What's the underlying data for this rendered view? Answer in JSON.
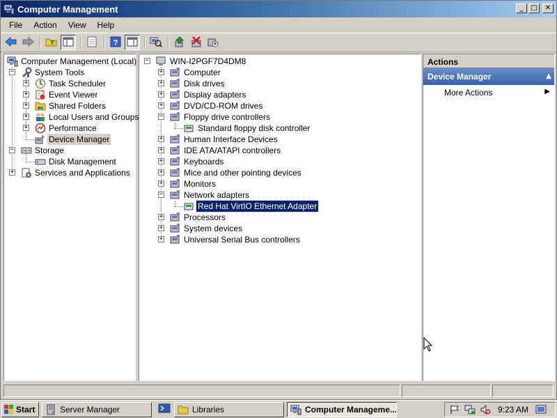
{
  "window": {
    "title": "Computer Management",
    "controls": {
      "minimize": "_",
      "maximize": "□",
      "close": "✕"
    }
  },
  "menu": [
    "File",
    "Action",
    "View",
    "Help"
  ],
  "toolbar": {
    "icons": [
      "back-arrow-icon",
      "forward-arrow-icon",
      "up-folder-icon",
      "show-hide-tree-icon",
      "properties-icon",
      "help-icon",
      "show-hide-action-pane-icon",
      "scan-hardware-icon",
      "update-driver-icon",
      "disable-device-icon",
      "uninstall-device-icon"
    ]
  },
  "left_tree": {
    "root": "Computer Management (Local)",
    "items": [
      {
        "label": "System Tools",
        "expander": "−"
      },
      {
        "label": "Task Scheduler",
        "expander": "+"
      },
      {
        "label": "Event Viewer",
        "expander": "+"
      },
      {
        "label": "Shared Folders",
        "expander": "+"
      },
      {
        "label": "Local Users and Groups",
        "expander": "+"
      },
      {
        "label": "Performance",
        "expander": "+"
      },
      {
        "label": "Device Manager",
        "expander": ""
      },
      {
        "label": "Storage",
        "expander": "−"
      },
      {
        "label": "Disk Management",
        "expander": ""
      },
      {
        "label": "Services and Applications",
        "expander": "+"
      }
    ]
  },
  "device_tree": {
    "root": "WIN-I2PGF7D4DM8",
    "items": [
      {
        "label": "Computer",
        "expander": "+"
      },
      {
        "label": "Disk drives",
        "expander": "+"
      },
      {
        "label": "Display adapters",
        "expander": "+"
      },
      {
        "label": "DVD/CD-ROM drives",
        "expander": "+"
      },
      {
        "label": "Floppy drive controllers",
        "expander": "−"
      },
      {
        "label": "Standard floppy disk controller",
        "expander": ""
      },
      {
        "label": "Human Interface Devices",
        "expander": "+"
      },
      {
        "label": "IDE ATA/ATAPI controllers",
        "expander": "+"
      },
      {
        "label": "Keyboards",
        "expander": "+"
      },
      {
        "label": "Mice and other pointing devices",
        "expander": "+"
      },
      {
        "label": "Monitors",
        "expander": "+"
      },
      {
        "label": "Network adapters",
        "expander": "−"
      },
      {
        "label": "Red Hat VirtIO Ethernet Adapter",
        "expander": ""
      },
      {
        "label": "Processors",
        "expander": "+"
      },
      {
        "label": "System devices",
        "expander": "+"
      },
      {
        "label": "Universal Serial Bus controllers",
        "expander": "+"
      }
    ]
  },
  "actions": {
    "header": "Actions",
    "section": "Device Manager",
    "item": "More Actions"
  },
  "taskbar": {
    "start": "Start",
    "tasks": [
      "Server Manager",
      "Libraries",
      "Computer Manageme..."
    ],
    "clock": "9:23 AM"
  },
  "colors": {
    "selection": "#0a246a",
    "actions_section": "#3a62a8",
    "face": "#d4d0c8"
  }
}
